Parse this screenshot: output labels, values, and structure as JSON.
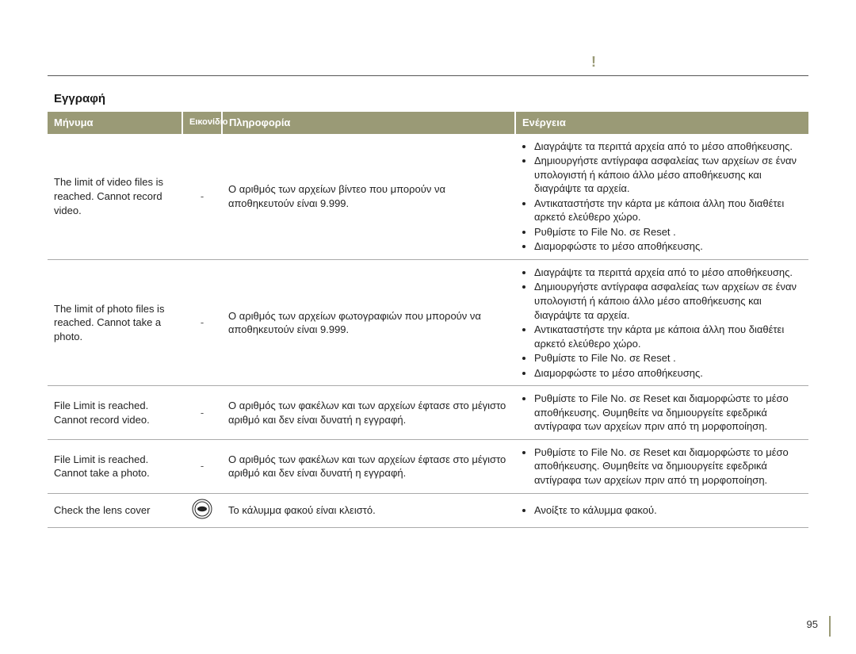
{
  "bang": "!",
  "section_title": "Εγγραφή",
  "headers": {
    "message": "Μήνυμα",
    "icon": "Εικονίδιο",
    "info": "Πληροφορία",
    "action": "Ενέργεια"
  },
  "rows": [
    {
      "message": "The limit of video files is reached. Cannot record video.",
      "icon": "-",
      "info": "Ο αριθμός των αρχείων βίντεο που μπορούν να αποθηκευτούν είναι 9.999.",
      "actions": [
        "Διαγράψτε τα περιττά αρχεία από το μέσο αποθήκευσης.",
        "Δημιουργήστε αντίγραφα ασφαλείας των αρχείων σε έναν υπολογιστή ή κάποιο άλλο μέσο αποθήκευσης και διαγράψτε τα αρχεία.",
        "Αντικαταστήστε την κάρτα με κάποια άλλη που διαθέτει αρκετό ελεύθερο χώρο.",
        "Ρυθμίστε το  File No.   σε  Reset .",
        "Διαμορφώστε το μέσο αποθήκευσης."
      ]
    },
    {
      "message": "The limit of photo files is reached. Cannot take a photo.",
      "icon": "-",
      "info": "Ο αριθμός των αρχείων φωτογραφιών που μπορούν να αποθηκευτούν είναι 9.999.",
      "actions": [
        "Διαγράψτε τα περιττά αρχεία από το μέσο αποθήκευσης.",
        "Δημιουργήστε αντίγραφα ασφαλείας των αρχείων σε έναν υπολογιστή ή κάποιο άλλο μέσο αποθήκευσης και διαγράψτε τα αρχεία.",
        "Αντικαταστήστε την κάρτα με κάποια άλλη που διαθέτει αρκετό ελεύθερο χώρο.",
        "Ρυθμίστε το  File No.   σε  Reset .",
        "Διαμορφώστε το μέσο αποθήκευσης."
      ]
    },
    {
      "message": "File Limit is reached. Cannot record video.",
      "icon": "-",
      "info": "Ο αριθμός των φακέλων και των αρχείων έφτασε στο μέγιστο αριθμό και δεν είναι δυνατή η εγγραφή.",
      "actions": [
        "Ρυθμίστε το  File No.   σε  Reset  και διαμορφώστε το μέσο αποθήκευσης. Θυμηθείτε να δημιουργείτε εφεδρικά αντίγραφα των αρχείων πριν από τη μορφοποίηση."
      ]
    },
    {
      "message": "File Limit is reached. Cannot take a photo.",
      "icon": "-",
      "info": "Ο αριθμός των φακέλων και των αρχείων έφτασε στο μέγιστο αριθμό και δεν είναι δυνατή η εγγραφή.",
      "actions": [
        "Ρυθμίστε το  File No.   σε  Reset  και διαμορφώστε το μέσο αποθήκευσης. Θυμηθείτε να δημιουργείτε εφεδρικά αντίγραφα των αρχείων πριν από τη μορφοποίηση."
      ]
    },
    {
      "message": "Check the lens cover",
      "icon": "lens",
      "info": "Το κάλυμμα φακού είναι κλειστό.",
      "actions": [
        "Ανοίξτε το κάλυμμα φακού."
      ]
    }
  ],
  "page_number": "95"
}
